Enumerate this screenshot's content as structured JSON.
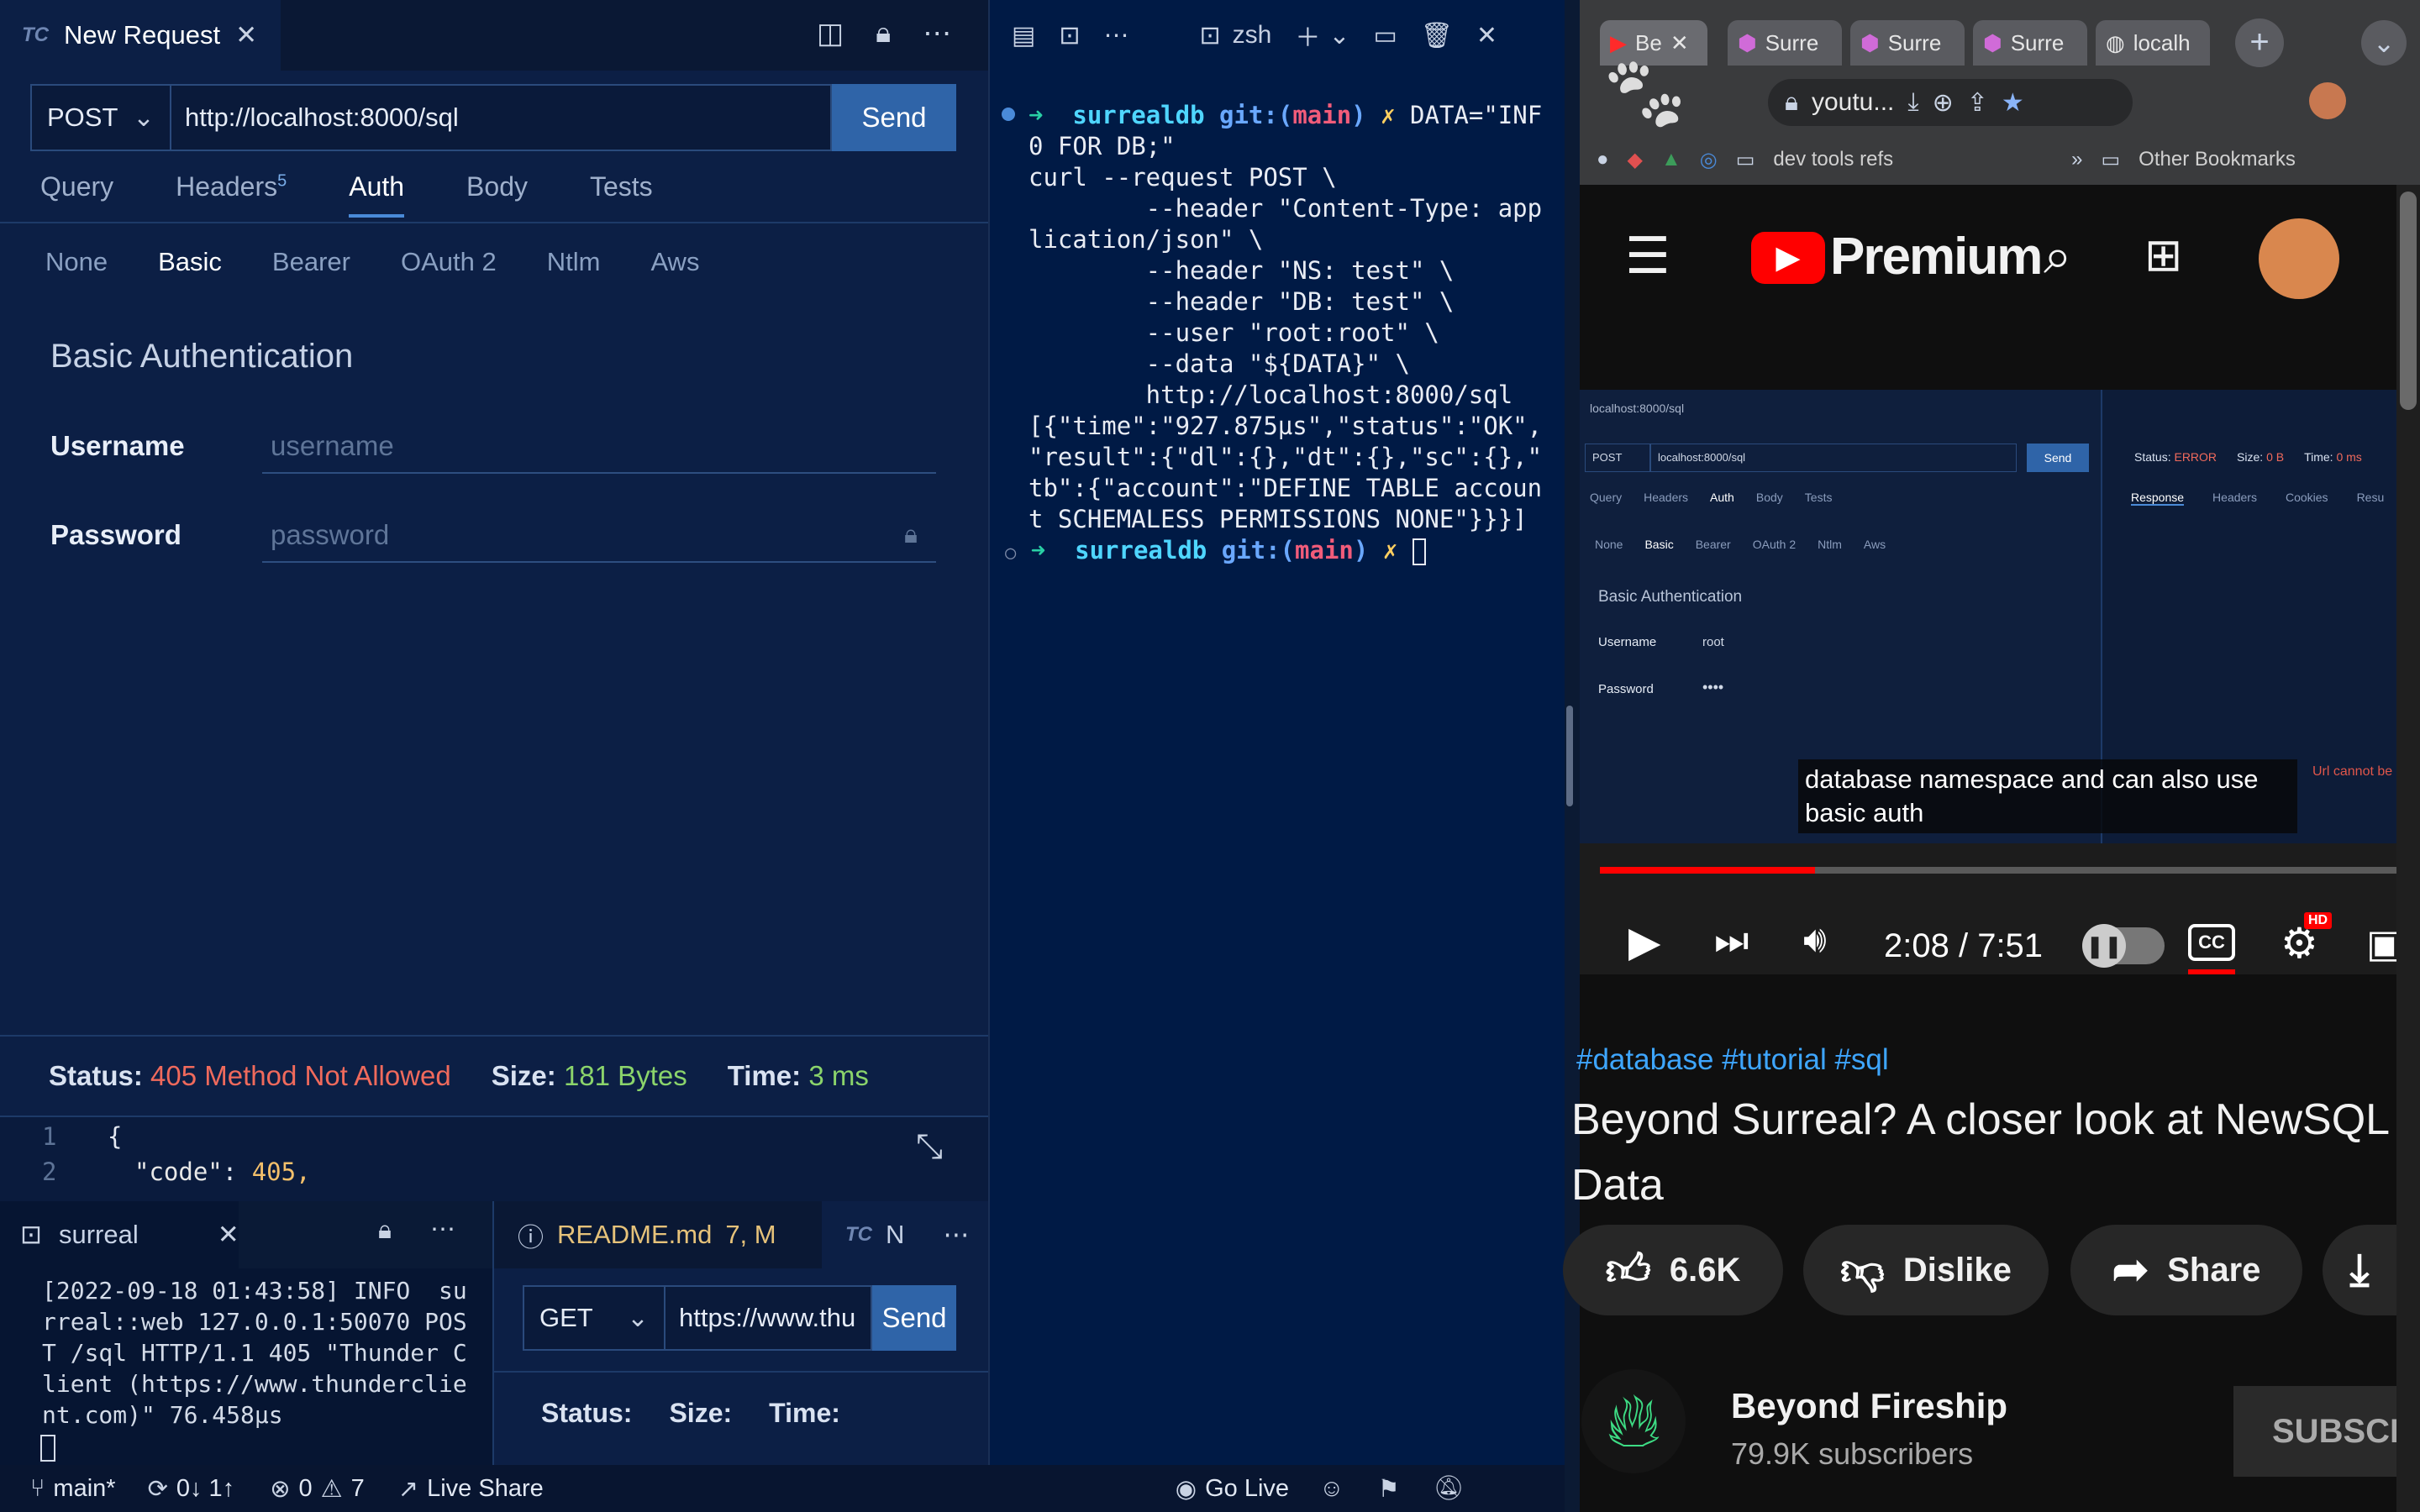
{
  "left": {
    "tab_logo": "TC",
    "tab_title": "New Request",
    "method": "POST",
    "url": "http://localhost:8000/sql",
    "send": "Send",
    "tabs": [
      "Query",
      "Headers",
      "Auth",
      "Body",
      "Tests"
    ],
    "headers_count": "5",
    "auth_types": [
      "None",
      "Basic",
      "Bearer",
      "OAuth 2",
      "Ntlm",
      "Aws"
    ],
    "section_title": "Basic Authentication",
    "username_label": "Username",
    "username_placeholder": "username",
    "password_label": "Password",
    "password_placeholder": "password",
    "status_label": "Status:",
    "status_value": "405 Method Not Allowed",
    "size_label": "Size:",
    "size_value": "181 Bytes",
    "time_label": "Time:",
    "time_value": "3 ms",
    "code_lines": [
      {
        "n": "1",
        "text": "{"
      },
      {
        "n": "2",
        "key": "\"code\"",
        "val": "405,"
      }
    ]
  },
  "bottom_left": {
    "tab": "surreal",
    "log": "[2022-09-18 01:43:58] INFO  su\nrreal::web 127.0.0.1:50070 POS\nT /sql HTTP/1.1 405 \"Thunder C\nlient (https://www.thunderclie\nnt.com)\" 76.458µs"
  },
  "bottom_right": {
    "readme_tab": "README.md",
    "readme_badge": "7, M",
    "tc_tab": "N",
    "method": "GET",
    "url": "https://www.thu",
    "send": "Send",
    "status_label": "Status:",
    "size_label": "Size:",
    "time_label": "Time:"
  },
  "statusbar": {
    "branch": "main*",
    "sync": "0↓ 1↑",
    "errors": "0",
    "warnings": "7",
    "live_share": "Live Share",
    "go_live": "Go Live"
  },
  "terminal": {
    "tab": "zsh",
    "line1_dir": "surrealdb",
    "line1_git": "git:(",
    "line1_branch": "main",
    "line1_git_end": ")",
    "line1_x": "✗",
    "line1_cmd": " DATA=\"INF",
    "body": "0 FOR DB;\"\ncurl --request POST \\\n        --header \"Content-Type: app\nlication/json\" \\\n        --header \"NS: test\" \\\n        --header \"DB: test\" \\\n        --user \"root:root\" \\\n        --data \"${DATA}\" \\\n        http://localhost:8000/sql\n[{\"time\":\"927.875µs\",\"status\":\"OK\",\n\"result\":{\"dl\":{},\"dt\":{},\"sc\":{},\"\ntb\":{\"account\":\"DEFINE TABLE accoun\nt SCHEMALESS PERMISSIONS NONE\"}}}]"
  },
  "browser": {
    "tabs": [
      "Be",
      "Surre",
      "Surre",
      "Surre",
      "localh"
    ],
    "address": "youtu...",
    "bookmark_folder": "dev tools refs",
    "other_bookmarks": "Other Bookmarks",
    "brand": "Premium",
    "video": {
      "inner_url": "localhost:8000/sql",
      "inner_method": "POST",
      "inner_send": "Send",
      "inner_tabs": [
        "Query",
        "Headers",
        "Auth",
        "Body",
        "Tests"
      ],
      "inner_auth": [
        "None",
        "Basic",
        "Bearer",
        "OAuth 2",
        "Ntlm",
        "Aws"
      ],
      "inner_title": "Basic Authentication",
      "inner_username": "Username",
      "inner_user_val": "root",
      "inner_password": "Password",
      "inner_pass_val": "••••",
      "inner_status_label": "Status:",
      "inner_status": "ERROR",
      "inner_size_label": "Size:",
      "inner_size": "0 B",
      "inner_time_label": "Time:",
      "inner_time": "0 ms",
      "inner_resp_tabs": [
        "Response",
        "Headers",
        "Cookies",
        "Resu"
      ],
      "inner_error": "Url cannot be",
      "caption": "database namespace and can also use basic auth",
      "time": "2:08 / 7:51",
      "progress": 0.27
    },
    "hashtags": "#database #tutorial #sql",
    "title_line1": "Beyond Surreal? A closer look at NewSQL",
    "title_line2": "Data",
    "likes": "6.6K",
    "dislike": "Dislike",
    "share": "Share",
    "channel": "Beyond Fireship",
    "subscribers": "79.9K subscribers",
    "subscribe": "SUBSCR"
  }
}
